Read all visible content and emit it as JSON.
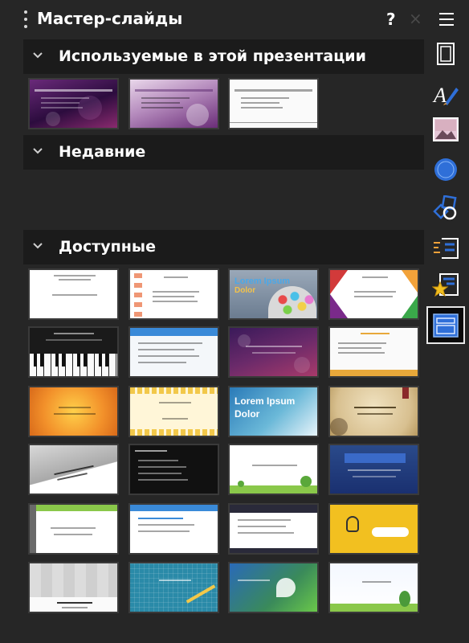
{
  "panel": {
    "title": "Мастер-слайды",
    "help_label": "?",
    "close_label": "×"
  },
  "sections": {
    "used": {
      "label": "Используемые в этой презентации"
    },
    "recent": {
      "label": "Недавние"
    },
    "available": {
      "label": "Доступные"
    }
  },
  "used_thumbs": [
    {
      "name": "used-master-1",
      "theme": "purple-bokeh"
    },
    {
      "name": "used-master-2",
      "theme": "pink-light"
    },
    {
      "name": "used-master-3",
      "theme": "white-lines"
    }
  ],
  "available_thumbs": {
    "lorem_bubbles": "Lorem Ipsum",
    "lorem_bubbles_sub": "Dolor",
    "lorem_blue": "Lorem Ipsum",
    "lorem_blue_sub": "Dolor"
  },
  "toolbar": {
    "menu_icon": "hamburger-icon",
    "items": [
      {
        "icon": "slide-properties-icon",
        "active": false
      },
      {
        "icon": "text-format-icon",
        "active": false
      },
      {
        "icon": "image-icon",
        "active": false
      },
      {
        "icon": "navigator-icon",
        "active": false
      },
      {
        "icon": "shapes-icon",
        "active": false
      },
      {
        "icon": "slide-transition-icon",
        "active": false
      },
      {
        "icon": "animation-icon",
        "active": false
      },
      {
        "icon": "master-slides-icon",
        "active": true
      }
    ]
  },
  "colors": {
    "background": "#262626",
    "section_bar": "#1b1b1b",
    "toolbar_active_border": "#e8e8e8",
    "accent_blue": "#2f6fd8"
  }
}
